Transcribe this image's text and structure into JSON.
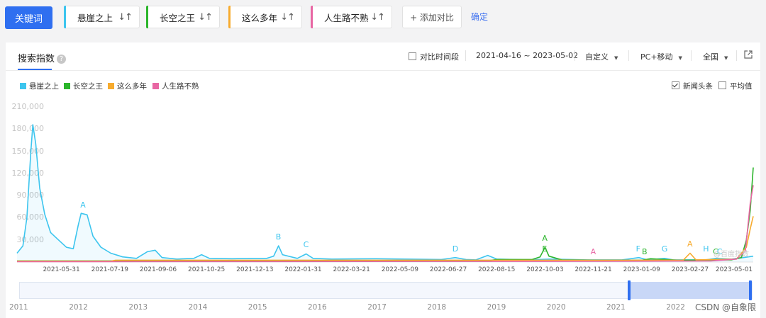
{
  "header": {
    "keyword_button": "关键词",
    "terms": [
      {
        "label": "悬崖之上",
        "color": "#3dc5ee"
      },
      {
        "label": "长空之王",
        "color": "#2bb52b"
      },
      {
        "label": "这么多年",
        "color": "#f7ab2e"
      },
      {
        "label": "人生路不熟",
        "color": "#e866a3"
      }
    ],
    "sort_icon": "↓↑",
    "add_button": "+ 添加对比",
    "confirm": "确定"
  },
  "panel": {
    "tab_title": "搜索指数",
    "help_icon": "?",
    "compare_period_label": "对比时间段",
    "date_range": "2021-04-16 ~ 2023-05-02",
    "custom_label": "自定义",
    "device_label": "PC+移动",
    "region_label": "全国",
    "export_icon": "external-link-icon",
    "news_label": "新闻头条",
    "news_checked": true,
    "average_label": "平均值",
    "average_checked": false,
    "watermark": "@百度指数",
    "credit": "CSDN @自象限"
  },
  "chart_data": {
    "type": "line",
    "y_ticks": [
      "210,000",
      "180,000",
      "150,000",
      "120,000",
      "90,000",
      "60,000",
      "30,000"
    ],
    "ylim": [
      0,
      210000
    ],
    "x_ticks": [
      "2021-05-31",
      "2021-07-19",
      "2021-09-06",
      "2021-10-25",
      "2021-12-13",
      "2022-01-31",
      "2022-03-21",
      "2022-05-09",
      "2022-06-27",
      "2022-08-15",
      "2022-10-03",
      "2022-11-21",
      "2023-01-09",
      "2023-02-27",
      "2023-05-01"
    ],
    "start": "2021-04-16",
    "end": "2023-05-02",
    "series": [
      {
        "name": "悬崖之上",
        "color": "#3dc5ee",
        "fill": true,
        "points": [
          [
            "2021-04-16",
            12000
          ],
          [
            "2021-04-22",
            22000
          ],
          [
            "2021-04-26",
            60000
          ],
          [
            "2021-04-30",
            150000
          ],
          [
            "2021-05-02",
            186000
          ],
          [
            "2021-05-05",
            160000
          ],
          [
            "2021-05-09",
            100000
          ],
          [
            "2021-05-14",
            65000
          ],
          [
            "2021-05-20",
            40000
          ],
          [
            "2021-05-28",
            30000
          ],
          [
            "2021-06-05",
            20000
          ],
          [
            "2021-06-12",
            18000
          ],
          [
            "2021-06-17",
            50000
          ],
          [
            "2021-06-20",
            66000
          ],
          [
            "2021-06-26",
            64000
          ],
          [
            "2021-07-02",
            35000
          ],
          [
            "2021-07-10",
            20000
          ],
          [
            "2021-07-20",
            12000
          ],
          [
            "2021-08-01",
            7000
          ],
          [
            "2021-08-15",
            5000
          ],
          [
            "2021-08-26",
            14000
          ],
          [
            "2021-09-03",
            16000
          ],
          [
            "2021-09-10",
            6000
          ],
          [
            "2021-09-25",
            4000
          ],
          [
            "2021-10-12",
            5000
          ],
          [
            "2021-10-20",
            10000
          ],
          [
            "2021-10-28",
            5000
          ],
          [
            "2021-11-20",
            4500
          ],
          [
            "2021-12-10",
            5000
          ],
          [
            "2021-12-25",
            5000
          ],
          [
            "2022-01-01",
            8000
          ],
          [
            "2022-01-06",
            22000
          ],
          [
            "2022-01-10",
            10000
          ],
          [
            "2022-01-25",
            5000
          ],
          [
            "2022-02-03",
            11000
          ],
          [
            "2022-02-10",
            5000
          ],
          [
            "2022-03-01",
            4000
          ],
          [
            "2022-04-15",
            4500
          ],
          [
            "2022-06-20",
            3500
          ],
          [
            "2022-07-04",
            6000
          ],
          [
            "2022-07-15",
            3500
          ],
          [
            "2022-07-25",
            3000
          ],
          [
            "2022-08-06",
            9000
          ],
          [
            "2022-08-15",
            4000
          ],
          [
            "2022-09-15",
            3000
          ],
          [
            "2022-10-08",
            4000
          ],
          [
            "2022-11-15",
            3000
          ],
          [
            "2022-12-20",
            3000
          ],
          [
            "2023-01-06",
            6000
          ],
          [
            "2023-01-15",
            3000
          ],
          [
            "2023-02-01",
            5000
          ],
          [
            "2023-02-10",
            3000
          ],
          [
            "2023-03-15",
            3000
          ],
          [
            "2023-03-25",
            5000
          ],
          [
            "2023-04-10",
            4000
          ],
          [
            "2023-04-22",
            6000
          ],
          [
            "2023-05-02",
            8000
          ]
        ]
      },
      {
        "name": "长空之王",
        "color": "#2bb52b",
        "fill": false,
        "points": [
          [
            "2021-04-16",
            1500
          ],
          [
            "2022-08-05",
            1500
          ],
          [
            "2022-08-15",
            3500
          ],
          [
            "2022-09-20",
            3500
          ],
          [
            "2022-09-28",
            7000
          ],
          [
            "2022-10-03",
            20000
          ],
          [
            "2022-10-07",
            8000
          ],
          [
            "2022-10-20",
            3000
          ],
          [
            "2022-12-01",
            2500
          ],
          [
            "2023-01-09",
            2500
          ],
          [
            "2023-01-18",
            4500
          ],
          [
            "2023-02-15",
            2500
          ],
          [
            "2023-04-10",
            3000
          ],
          [
            "2023-04-20",
            6000
          ],
          [
            "2023-04-25",
            30000
          ],
          [
            "2023-04-29",
            70000
          ],
          [
            "2023-05-02",
            128000
          ]
        ]
      },
      {
        "name": "这么多年",
        "color": "#f7ab2e",
        "fill": false,
        "points": [
          [
            "2021-04-16",
            1200
          ],
          [
            "2021-07-20",
            1200
          ],
          [
            "2021-07-25",
            2500
          ],
          [
            "2022-12-01",
            2500
          ],
          [
            "2023-02-20",
            2500
          ],
          [
            "2023-02-27",
            12000
          ],
          [
            "2023-03-05",
            3000
          ],
          [
            "2023-04-15",
            4000
          ],
          [
            "2023-04-25",
            20000
          ],
          [
            "2023-04-29",
            45000
          ],
          [
            "2023-05-02",
            62000
          ]
        ]
      },
      {
        "name": "人生路不熟",
        "color": "#e866a3",
        "fill": false,
        "points": [
          [
            "2021-04-16",
            500
          ],
          [
            "2022-11-21",
            1000
          ],
          [
            "2023-03-20",
            1500
          ],
          [
            "2023-04-15",
            4000
          ],
          [
            "2023-04-24",
            15000
          ],
          [
            "2023-04-29",
            80000
          ],
          [
            "2023-05-02",
            104000
          ]
        ]
      }
    ],
    "event_markers": [
      {
        "label": "A",
        "color": "#3dc5ee",
        "date": "2021-06-22",
        "value": 72000
      },
      {
        "label": "B",
        "color": "#3dc5ee",
        "date": "2022-01-06",
        "value": 29000
      },
      {
        "label": "C",
        "color": "#3dc5ee",
        "date": "2022-02-03",
        "value": 18000
      },
      {
        "label": "D",
        "color": "#3dc5ee",
        "date": "2022-07-04",
        "value": 12000
      },
      {
        "label": "A",
        "color": "#2bb52b",
        "date": "2022-10-03",
        "value": 27000
      },
      {
        "label": "E",
        "color": "#2bb52b",
        "date": "2022-10-03",
        "value": 12000
      },
      {
        "label": "A",
        "color": "#e866a3",
        "date": "2022-11-21",
        "value": 9000
      },
      {
        "label": "F",
        "color": "#3dc5ee",
        "date": "2023-01-06",
        "value": 12000
      },
      {
        "label": "B",
        "color": "#2bb52b",
        "date": "2023-01-12",
        "value": 8500
      },
      {
        "label": "G",
        "color": "#3dc5ee",
        "date": "2023-02-01",
        "value": 12000
      },
      {
        "label": "A",
        "color": "#f7ab2e",
        "date": "2023-02-27",
        "value": 19000
      },
      {
        "label": "H",
        "color": "#3dc5ee",
        "date": "2023-03-15",
        "value": 12000
      },
      {
        "label": "C",
        "color": "#2bb52b",
        "date": "2023-03-25",
        "value": 9000
      },
      {
        "label": "C",
        "color": "#3dc5ee",
        "date": "2023-03-29",
        "value": 9000
      }
    ]
  },
  "timeline": {
    "years": [
      "2011",
      "2012",
      "2013",
      "2014",
      "2015",
      "2016",
      "2017",
      "2018",
      "2019",
      "2020",
      "2021",
      "2022"
    ]
  }
}
